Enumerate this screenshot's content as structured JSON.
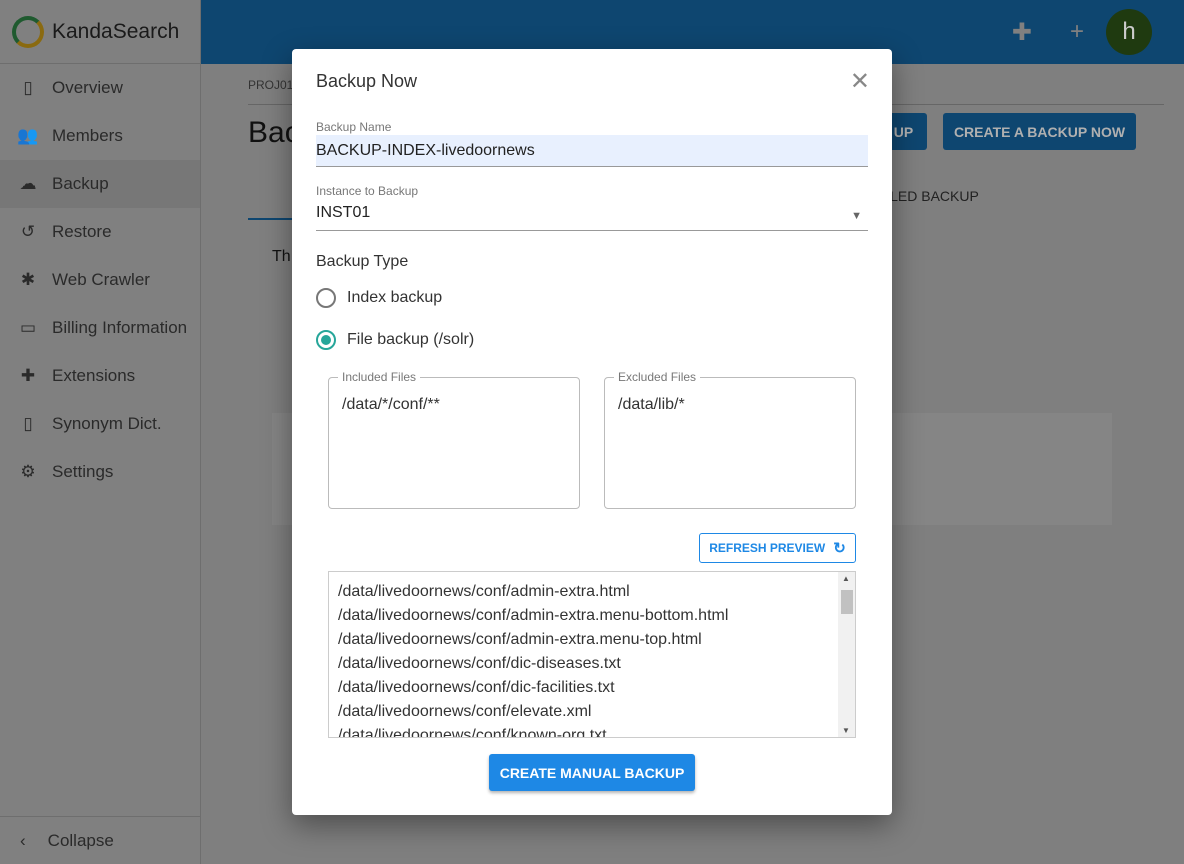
{
  "app": {
    "name": "KandaSearch"
  },
  "sidebar": {
    "items": [
      {
        "label": "Overview",
        "icon": "book-icon",
        "glyph": "▯"
      },
      {
        "label": "Members",
        "icon": "people-icon",
        "glyph": "👥"
      },
      {
        "label": "Backup",
        "icon": "cloud-upload-icon",
        "glyph": "☁"
      },
      {
        "label": "Restore",
        "icon": "history-icon",
        "glyph": "↺"
      },
      {
        "label": "Web Crawler",
        "icon": "bug-icon",
        "glyph": "✱"
      },
      {
        "label": "Billing Information",
        "icon": "credit-card-icon",
        "glyph": "▭"
      },
      {
        "label": "Extensions",
        "icon": "puzzle-icon",
        "glyph": "✚"
      },
      {
        "label": "Synonym Dict.",
        "icon": "book-icon",
        "glyph": "▯"
      },
      {
        "label": "Settings",
        "icon": "gear-icon",
        "glyph": "⚙"
      }
    ],
    "active": "Backup",
    "collapse": "Collapse"
  },
  "header": {
    "avatar": "h"
  },
  "page": {
    "breadcrumb": "PROJ01",
    "title": "Bac",
    "btn1": "UP",
    "btn2": "CREATE A BACKUP NOW",
    "tab": "ULED BACKUP",
    "text": "Th"
  },
  "modal": {
    "title": "Backup Now",
    "backup_name_label": "Backup Name",
    "backup_name_value": "BACKUP-INDEX-livedoornews",
    "instance_label": "Instance to Backup",
    "instance_value": "INST01",
    "backup_type_label": "Backup Type",
    "options": [
      "Index backup",
      "File backup (/solr)"
    ],
    "selected_option": "File backup (/solr)",
    "included_label": "Included Files",
    "included_value": "/data/*/conf/**",
    "excluded_label": "Excluded Files",
    "excluded_value": "/data/lib/*",
    "refresh_label": "REFRESH PREVIEW",
    "files": [
      "/data/livedoornews/conf/admin-extra.html",
      "/data/livedoornews/conf/admin-extra.menu-bottom.html",
      "/data/livedoornews/conf/admin-extra.menu-top.html",
      "/data/livedoornews/conf/dic-diseases.txt",
      "/data/livedoornews/conf/dic-facilities.txt",
      "/data/livedoornews/conf/elevate.xml",
      "/data/livedoornews/conf/known-org.txt"
    ],
    "create_label": "CREATE MANUAL BACKUP"
  },
  "colors": {
    "accent": "#1e88e5",
    "radio": "#26a69a",
    "header": "#1976d2"
  }
}
